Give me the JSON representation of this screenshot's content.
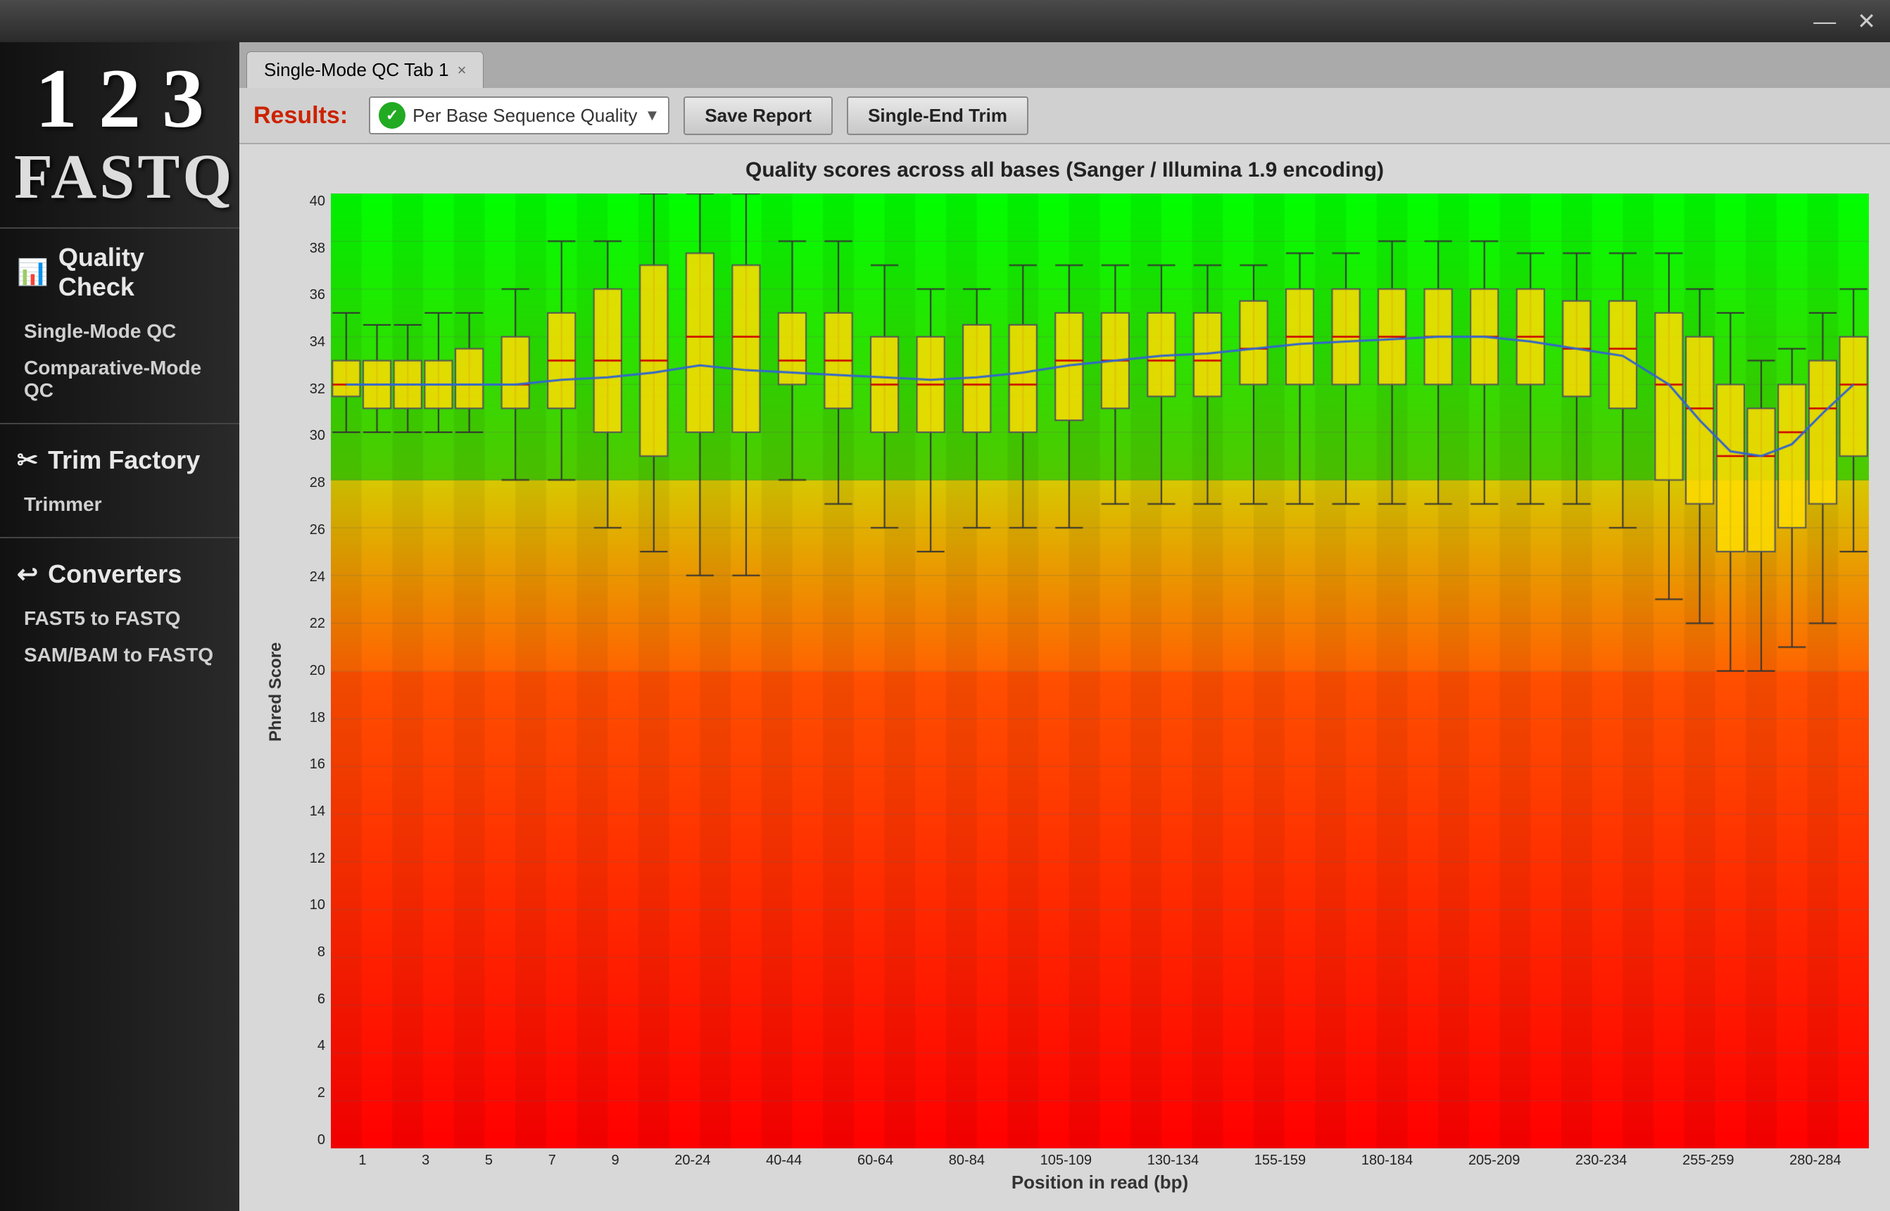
{
  "window": {
    "minimize_label": "—",
    "close_label": "✕"
  },
  "logo": {
    "numbers": "1 2 3",
    "text": "FASTQ"
  },
  "sidebar": {
    "quality_check_title": "Quality Check",
    "quality_check_icon": "📊",
    "single_mode_qc": "Single-Mode QC",
    "comparative_mode_qc": "Comparative-Mode QC",
    "trim_factory_title": "Trim Factory",
    "trim_factory_icon": "✂",
    "trimmer": "Trimmer",
    "converters_title": "Converters",
    "converters_icon": "↩",
    "fast5_to_fastq": "FAST5 to FASTQ",
    "sambam_to_fastq": "SAM/BAM to FASTQ"
  },
  "tab": {
    "label": "Single-Mode QC Tab 1",
    "close": "×"
  },
  "toolbar": {
    "results_label": "Results:",
    "dropdown_value": "Per Base Sequence Quality",
    "save_report_btn": "Save Report",
    "single_end_trim_btn": "Single-End Trim"
  },
  "chart": {
    "title": "Quality scores across all bases (Sanger / Illumina 1.9 encoding)",
    "y_axis_label": "Phred Score",
    "x_axis_label": "Position in read (bp)",
    "y_ticks": [
      "0",
      "2",
      "4",
      "6",
      "8",
      "10",
      "12",
      "14",
      "16",
      "18",
      "20",
      "22",
      "24",
      "26",
      "28",
      "30",
      "32",
      "34",
      "36",
      "38",
      "40"
    ],
    "x_ticks": [
      "1",
      "3",
      "5",
      "7",
      "9",
      "20-24",
      "40-44",
      "60-64",
      "80-84",
      "105-109",
      "130-134",
      "155-159",
      "180-184",
      "205-209",
      "230-234",
      "255-259",
      "280-284"
    ]
  }
}
